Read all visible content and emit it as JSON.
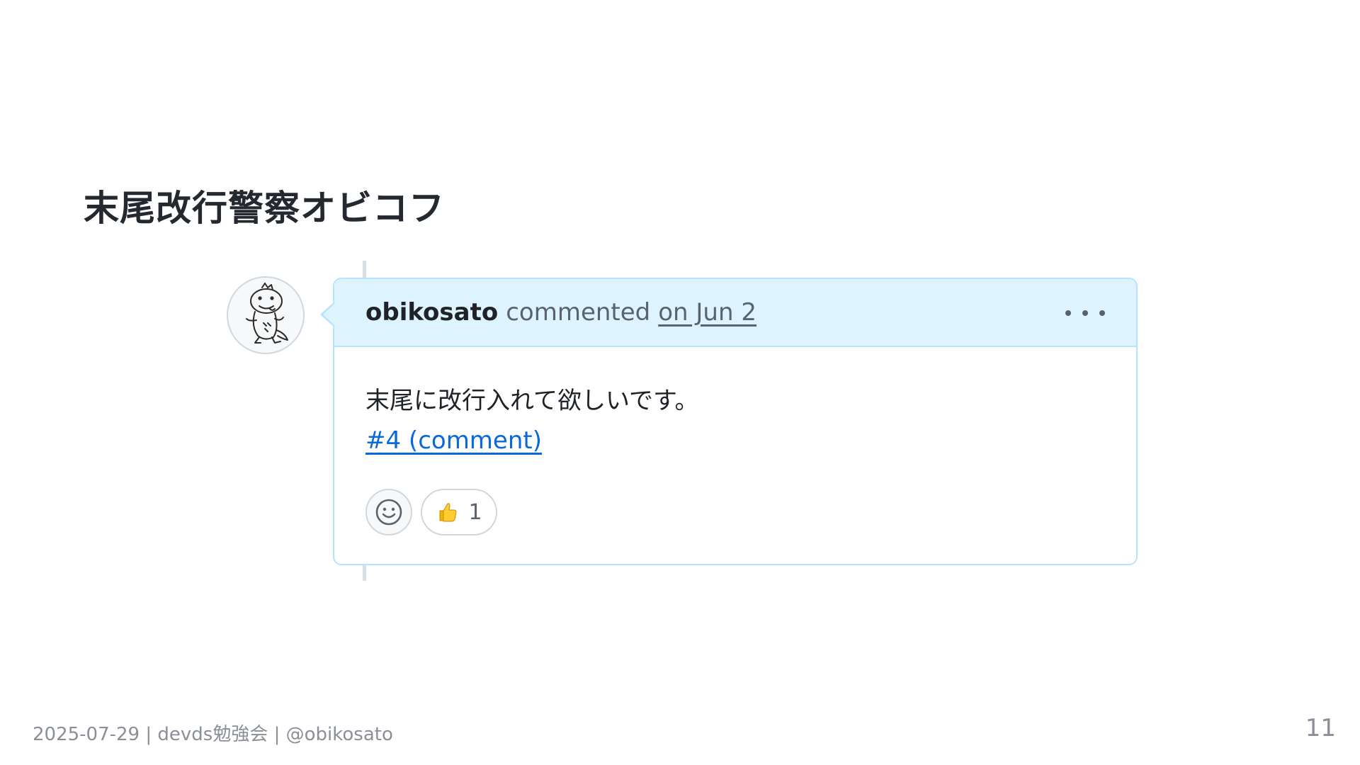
{
  "slide": {
    "title": "末尾改行警察オビコフ",
    "page_number": "11"
  },
  "footer": {
    "text": "2025-07-29 | devds勉強会 | @obikosato"
  },
  "comment": {
    "author": "obikosato",
    "action": "commented",
    "timestamp": "on Jun 2",
    "body_text": "末尾に改行入れて欲しいです。",
    "link_text": "#4 (comment)",
    "more_icon": "kebab-horizontal-icon",
    "reactions": [
      {
        "emoji": "👍",
        "icon": "thumbs-up-icon",
        "count": "1"
      }
    ],
    "reaction_picker_icon": "smiley-icon"
  },
  "colors": {
    "header_bg": "#ddf4ff",
    "border": "#b6e3ff",
    "link": "#0969da",
    "muted_text": "#59636e"
  }
}
